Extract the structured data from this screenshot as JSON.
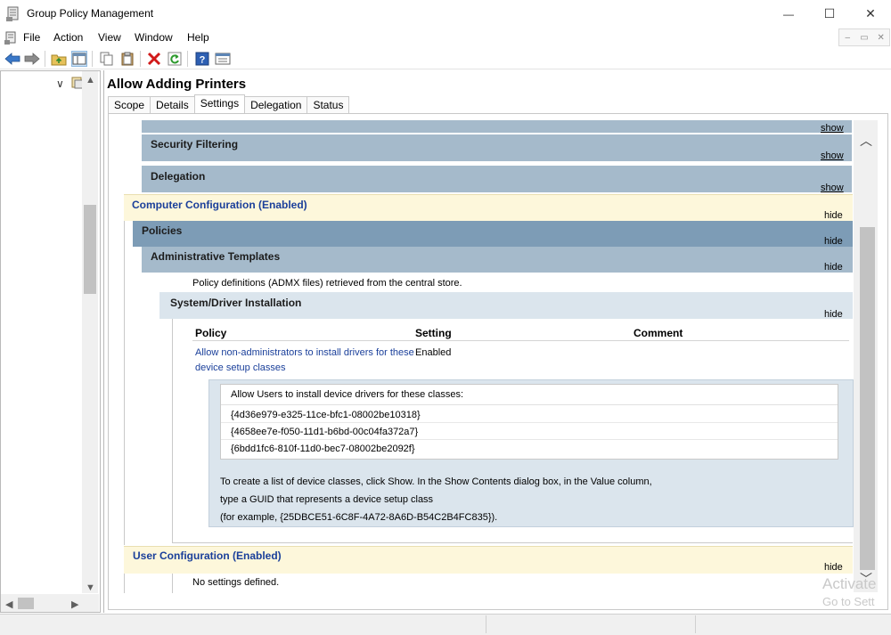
{
  "window": {
    "title": "Group Policy Management",
    "minimize_glyph": "—",
    "maximize_glyph": "☐",
    "close_glyph": "✕"
  },
  "menu": {
    "items": [
      {
        "label": "File"
      },
      {
        "label": "Action"
      },
      {
        "label": "View"
      },
      {
        "label": "Window"
      },
      {
        "label": "Help"
      }
    ],
    "mdi_buttons": [
      "–",
      "▭",
      "✕"
    ]
  },
  "toolbar": {
    "icons": [
      "back-icon",
      "forward-icon",
      "up-folder-icon",
      "show-hide-tree-icon",
      "copy-icon",
      "paste-icon",
      "delete-icon",
      "refresh-icon",
      "help-icon",
      "properties-icon"
    ]
  },
  "tree": {
    "expander_glyph": "∨"
  },
  "gpo": {
    "name": "Allow Adding Printers",
    "tabs": [
      {
        "label": "Scope",
        "active": false
      },
      {
        "label": "Details",
        "active": false
      },
      {
        "label": "Settings",
        "active": true
      },
      {
        "label": "Delegation",
        "active": false
      },
      {
        "label": "Status",
        "active": false
      }
    ]
  },
  "report": {
    "top_show_link": "show",
    "security_filtering": {
      "label": "Security Filtering",
      "action": "show"
    },
    "delegation": {
      "label": "Delegation",
      "action": "show"
    },
    "computer_configuration": {
      "label": "Computer Configuration (Enabled)",
      "action": "hide"
    },
    "policies": {
      "label": "Policies",
      "action": "hide"
    },
    "administrative_templates": {
      "label": "Administrative Templates",
      "action": "hide",
      "note": "Policy definitions (ADMX files) retrieved from the central store."
    },
    "system_driver_installation": {
      "label": "System/Driver Installation",
      "action": "hide"
    },
    "table": {
      "headers": {
        "policy": "Policy",
        "setting": "Setting",
        "comment": "Comment"
      },
      "row": {
        "policy_line1": "Allow non-administrators to install drivers for these",
        "policy_line2": "device setup classes",
        "setting": "Enabled",
        "comment": ""
      }
    },
    "details": {
      "list_title": "Allow Users to install device drivers for these classes:",
      "guids": [
        "{4d36e979-e325-11ce-bfc1-08002be10318}",
        "{4658ee7e-f050-11d1-b6bd-00c04fa372a7}",
        "{6bdd1fc6-810f-11d0-bec7-08002be2092f}"
      ],
      "explain": [
        "To create a list of device classes, click Show. In the Show Contents dialog box, in the Value column,",
        "type a GUID that represents a device setup class",
        "(for example, {25DBCE51-6C8F-4A72-8A6D-B54C2B4FC835})."
      ]
    },
    "user_configuration": {
      "label": "User Configuration (Enabled)",
      "action": "hide",
      "note": "No settings defined."
    }
  },
  "watermark": {
    "line1": "Activate",
    "line2": "Go to Sett"
  },
  "colors": {
    "dark_band": "#7d9cb6",
    "mid_band": "#a5bacb",
    "light_band": "#dbe5ed",
    "config_band": "#fdf7db",
    "link_blue": "#1a3f9a"
  }
}
